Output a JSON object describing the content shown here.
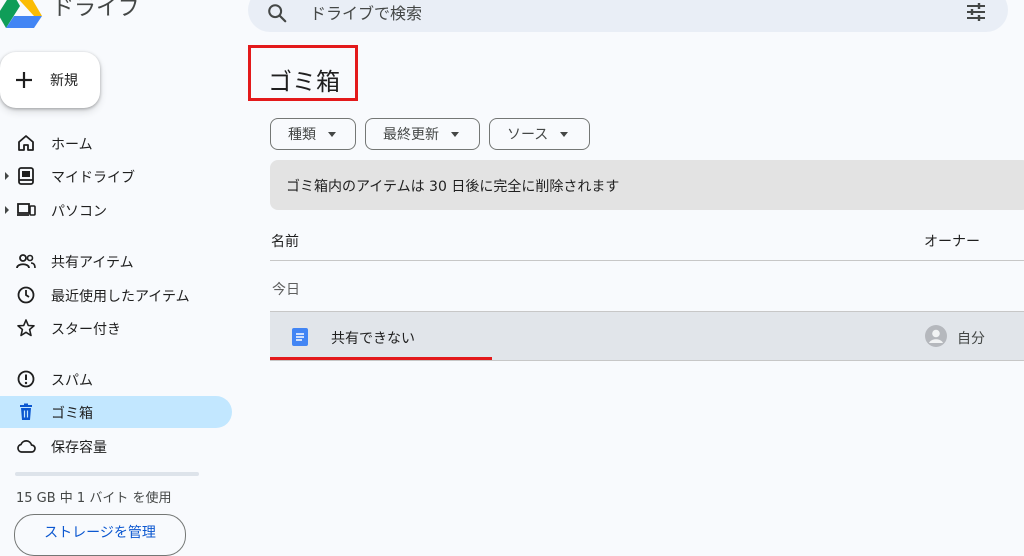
{
  "app": {
    "title": "ドライブ"
  },
  "search": {
    "placeholder": "ドライブで検索"
  },
  "new_button": {
    "label": "新規"
  },
  "sidebar": {
    "items": [
      {
        "label": "ホーム",
        "icon": "home-icon"
      },
      {
        "label": "マイドライブ",
        "icon": "my-drive-icon"
      },
      {
        "label": "パソコン",
        "icon": "computers-icon"
      },
      {
        "label": "共有アイテム",
        "icon": "shared-icon"
      },
      {
        "label": "最近使用したアイテム",
        "icon": "recent-icon"
      },
      {
        "label": "スター付き",
        "icon": "star-icon"
      },
      {
        "label": "スパム",
        "icon": "spam-icon"
      },
      {
        "label": "ゴミ箱",
        "icon": "trash-icon",
        "active": true
      },
      {
        "label": "保存容量",
        "icon": "cloud-icon"
      }
    ]
  },
  "storage": {
    "usage_text": "15 GB 中 1 バイト を使用",
    "manage_label": "ストレージを管理",
    "used_fraction": 0.0
  },
  "main": {
    "title": "ゴミ箱",
    "filters": [
      {
        "label": "種類"
      },
      {
        "label": "最終更新"
      },
      {
        "label": "ソース"
      }
    ],
    "banner": "ゴミ箱内のアイテムは 30 日後に完全に削除されます",
    "columns": {
      "name": "名前",
      "owner": "オーナー"
    },
    "groups": [
      {
        "label": "今日",
        "files": [
          {
            "name": "共有できない",
            "owner": "自分",
            "icon": "google-docs-icon"
          }
        ]
      }
    ]
  },
  "colors": {
    "accent": "#0b57d0",
    "active_nav": "#c2e7ff",
    "highlight_red": "#e3191b",
    "docs_blue": "#4285f4"
  }
}
